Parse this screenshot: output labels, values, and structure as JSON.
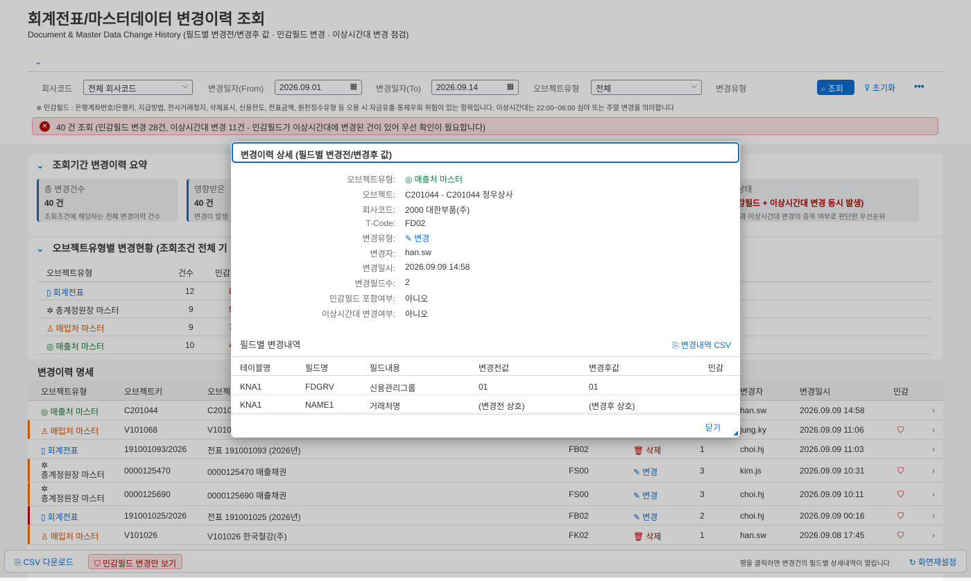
{
  "header": {
    "title": "회계전표/마스터데이터 변경이력 조회",
    "subtitle": "Document & Master Data Change History (필드별 변경전/변경후 값 · 민감필드 변경 · 이상시간대 변경 점검)"
  },
  "filters": {
    "company_label": "회사코드",
    "company_value": "전체 회사코드",
    "from_label": "변경일자(From)",
    "from_value": "2026.09.01",
    "to_label": "변경일자(To)",
    "to_value": "2026.09.14",
    "objtype_label": "오브젝트유형",
    "objtype_value": "전체",
    "changetype_label": "변경유형",
    "search_label": "조회",
    "reset_label": "초기화",
    "more_label": "•••"
  },
  "note": "※ 민감필드 : 은행계좌번호/은행키, 지급방법, 전사거래정지, 삭제표시, 신용한도, 전표금액, 원천징수유형 등 오용 시 자금유출·통제우회 위험이 있는 항목입니다. 이상시간대는 22:00~06:00 심야 또는 주말 변경을 의미합니다",
  "error_message": "40 건 조회 (민감필드 변경 28건, 이상시간대 변경 11건 - 민감필드가 이상시간대에 변경된 건이 있어 우선 확인이 필요합니다)",
  "summary": {
    "title": "조회기간 변경이력 요약",
    "kpis": [
      {
        "label": "총 변경건수",
        "value": "40 건",
        "sub": "조회조건에 해당하는 전체 변경이력 건수"
      },
      {
        "label": "영향받은",
        "value": "40 건",
        "sub": "변경이 발생"
      },
      {
        "label": "토 상태",
        "value": "(민감필드 + 이상시간대 변경 동시 발생)",
        "sub": "변경과 이상시간대 변경의 중복 여부로 판단한 우선순위"
      }
    ]
  },
  "by_type": {
    "title": "오브젝트유형별 변경현황 (조회조건 전체 기",
    "headers": [
      "오브젝트유형",
      "건수",
      "민감"
    ],
    "rows": [
      {
        "type": "회계전표",
        "count": "12",
        "sens": "8"
      },
      {
        "type": "총계정원장 마스터",
        "count": "9",
        "sens": "9"
      },
      {
        "type": "매입처 마스터",
        "count": "9",
        "sens": "7"
      },
      {
        "type": "매출처 마스터",
        "count": "10",
        "sens": "4"
      }
    ]
  },
  "detail_table": {
    "title": "변경이력 명세",
    "headers": {
      "objtype": "오브젝트유형",
      "objkey": "오브젝트키",
      "obj": "오브젝",
      "user": "변경자",
      "time": "변경일시",
      "sens": "민감"
    },
    "rows": [
      {
        "type": "매출처 마스터",
        "key": "C201044",
        "obj": "C2010",
        "tcode": "",
        "change": "",
        "fields": "",
        "user": "han.sw",
        "time": "2026.09.09 14:58",
        "sens": false
      },
      {
        "type": "매입처 마스터",
        "key": "V101068",
        "obj": "V1010",
        "tcode": "",
        "change": "",
        "fields": "",
        "user": "jung.ky",
        "time": "2026.09.09 11:06",
        "sens": true
      },
      {
        "type": "회계전표",
        "key": "191001093/2026",
        "obj": "전표 191001093 (2026년)",
        "tcode": "FB02",
        "change": "삭제",
        "fields": "1",
        "user": "choi.hj",
        "time": "2026.09.09 11:03",
        "sens": false
      },
      {
        "type": "총계정원장 마스터",
        "key": "0000125470",
        "obj": "0000125470 매출채권",
        "tcode": "FS00",
        "change": "변경",
        "fields": "3",
        "user": "kim.js",
        "time": "2026.09.09 10:31",
        "sens": true
      },
      {
        "type": "총계정원장 마스터",
        "key": "0000125690",
        "obj": "0000125690 매출채권",
        "tcode": "FS00",
        "change": "변경",
        "fields": "3",
        "user": "choi.hj",
        "time": "2026.09.09 10:11",
        "sens": true
      },
      {
        "type": "회계전표",
        "key": "191001025/2026",
        "obj": "전표 191001025 (2026년)",
        "tcode": "FB02",
        "change": "변경",
        "fields": "2",
        "user": "choi.hj",
        "time": "2026.09.09 00:16",
        "sens": true
      },
      {
        "type": "매입처 마스터",
        "key": "V101026",
        "obj": "V101026 한국철강(주)",
        "tcode": "FK02",
        "change": "삭제",
        "fields": "1",
        "user": "han.sw",
        "time": "2026.09.08 17:45",
        "sens": true
      }
    ]
  },
  "footer": {
    "csv_label": "CSV 다운로드",
    "sens_only_label": "민감필드 변경만 보기",
    "hint": "행을 클릭하면 변경건의 필드별 상세내역이 열립니다",
    "reset_layout_label": "화면재설정"
  },
  "dialog": {
    "title": "변경이력 상세 (필드별 변경전/변경후 값)",
    "fields": [
      {
        "label": "오브젝트유형:",
        "value": "매출처 마스터"
      },
      {
        "label": "오브젝트:",
        "value": "C201044 - C201044 정우상사"
      },
      {
        "label": "회사코드:",
        "value": "2000 대한부품(주)"
      },
      {
        "label": "T-Code:",
        "value": "FD02"
      },
      {
        "label": "변경유형:",
        "value": "변경"
      },
      {
        "label": "변경자:",
        "value": "han.sw"
      },
      {
        "label": "변경일시:",
        "value": "2026.09.09 14:58"
      },
      {
        "label": "변경필드수:",
        "value": "2"
      },
      {
        "label": "민감필드 포함여부:",
        "value": "아니오"
      },
      {
        "label": "이상시간대 변경여부:",
        "value": "아니오"
      }
    ],
    "items_title": "필드별 변경내역",
    "csv_label": "변경내역 CSV",
    "items_headers": [
      "테이블명",
      "필드명",
      "필드내용",
      "변경전값",
      "변경후값",
      "민감"
    ],
    "items": [
      {
        "table": "KNA1",
        "field": "FDGRV",
        "desc": "신용관리그룹",
        "before": "01",
        "after": "01",
        "sens": ""
      },
      {
        "table": "KNA1",
        "field": "NAME1",
        "desc": "거래처명",
        "before": "(변경전 상호)",
        "after": "(변경후 상호)",
        "sens": ""
      }
    ],
    "close_label": "닫기"
  },
  "colors": {
    "accent": "#0a6ed1",
    "error": "#bb0000",
    "warning": "#c35500",
    "success": "#107e3e"
  }
}
